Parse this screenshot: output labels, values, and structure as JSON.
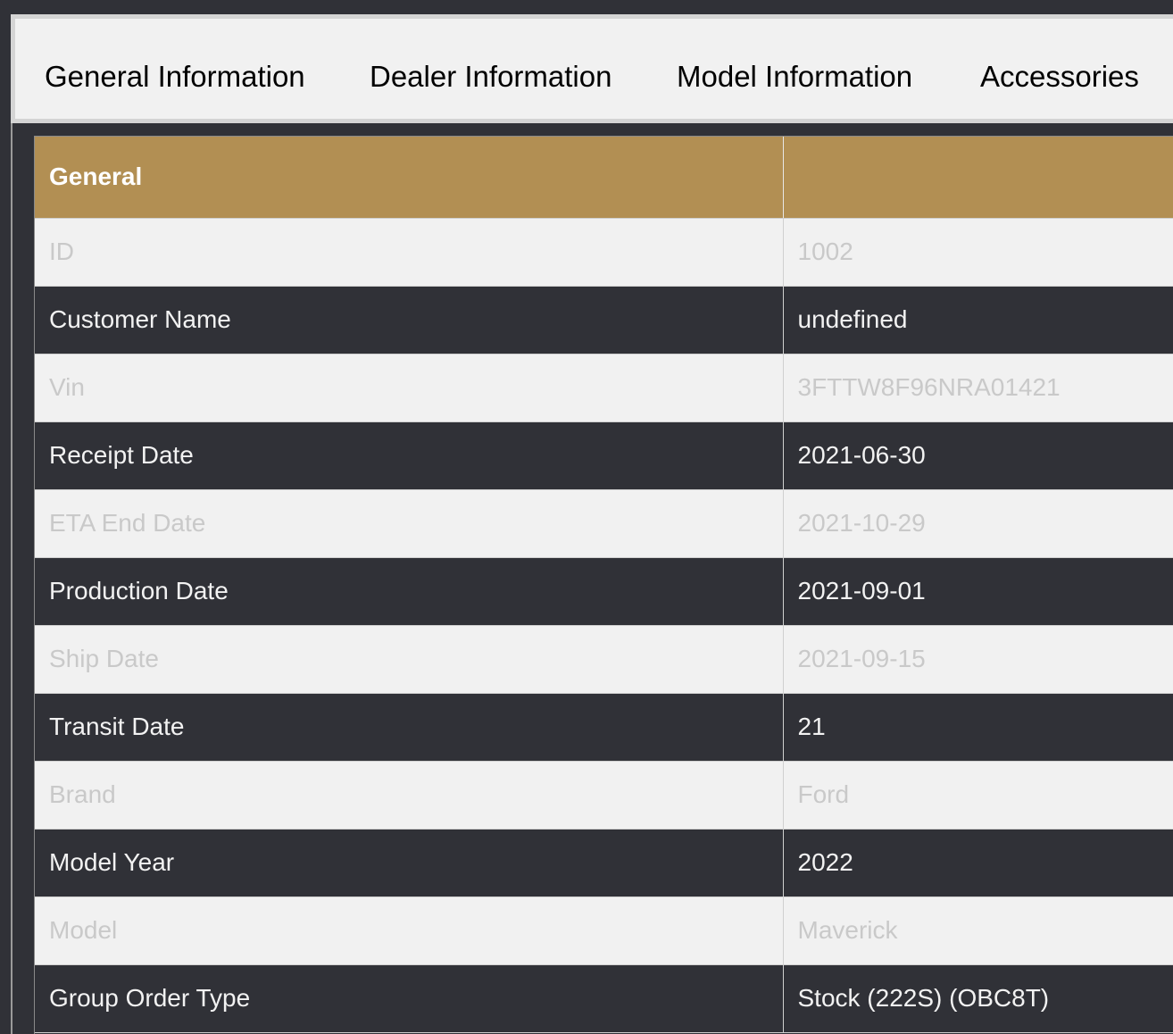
{
  "tabs": [
    {
      "label": "General Information"
    },
    {
      "label": "Dealer Information"
    },
    {
      "label": "Model Information"
    },
    {
      "label": "Accessories"
    }
  ],
  "table": {
    "header": {
      "section": "General",
      "value": ""
    },
    "rows": [
      {
        "label": "ID",
        "value": "1002"
      },
      {
        "label": "Customer Name",
        "value": "undefined"
      },
      {
        "label": "Vin",
        "value": "3FTTW8F96NRA01421"
      },
      {
        "label": "Receipt Date",
        "value": "2021-06-30"
      },
      {
        "label": "ETA End Date",
        "value": "2021-10-29"
      },
      {
        "label": "Production Date",
        "value": "2021-09-01"
      },
      {
        "label": "Ship Date",
        "value": "2021-09-15"
      },
      {
        "label": "Transit Date",
        "value": "21"
      },
      {
        "label": "Brand",
        "value": "Ford"
      },
      {
        "label": "Model Year",
        "value": "2022"
      },
      {
        "label": "Model",
        "value": "Maverick"
      },
      {
        "label": "Group Order Type",
        "value": "Stock (222S) (OBC8T)"
      }
    ]
  },
  "colors": {
    "header_bg": "#b28f53",
    "dark_row_bg": "#303137",
    "light_row_bg": "#f1f1f1"
  }
}
